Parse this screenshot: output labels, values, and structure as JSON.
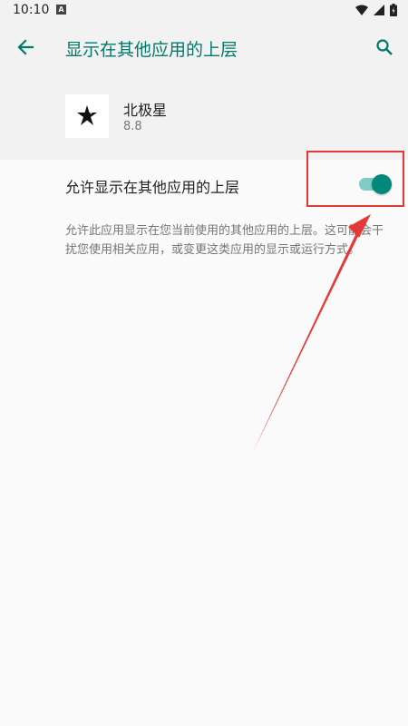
{
  "status_bar": {
    "time": "10:10",
    "app_icon": "A",
    "icons": [
      "wifi-icon",
      "signal-icon",
      "battery-icon"
    ]
  },
  "app_bar": {
    "title": "显示在其他应用的上层",
    "back_icon": "arrow-back-icon",
    "search_icon": "search-icon"
  },
  "app_info": {
    "name": "北极星",
    "version": "8.8"
  },
  "setting": {
    "label": "允许显示在其他应用的上层",
    "enabled": true
  },
  "description": "允许此应用显示在您当前使用的其他应用的上层。这可能会干扰您使用相关应用，或变更这类应用的显示或运行方式。",
  "colors": {
    "accent": "#00796b",
    "toggle_thumb": "#00897b",
    "toggle_track": "#80cbc4",
    "annotation": "#e53935"
  }
}
